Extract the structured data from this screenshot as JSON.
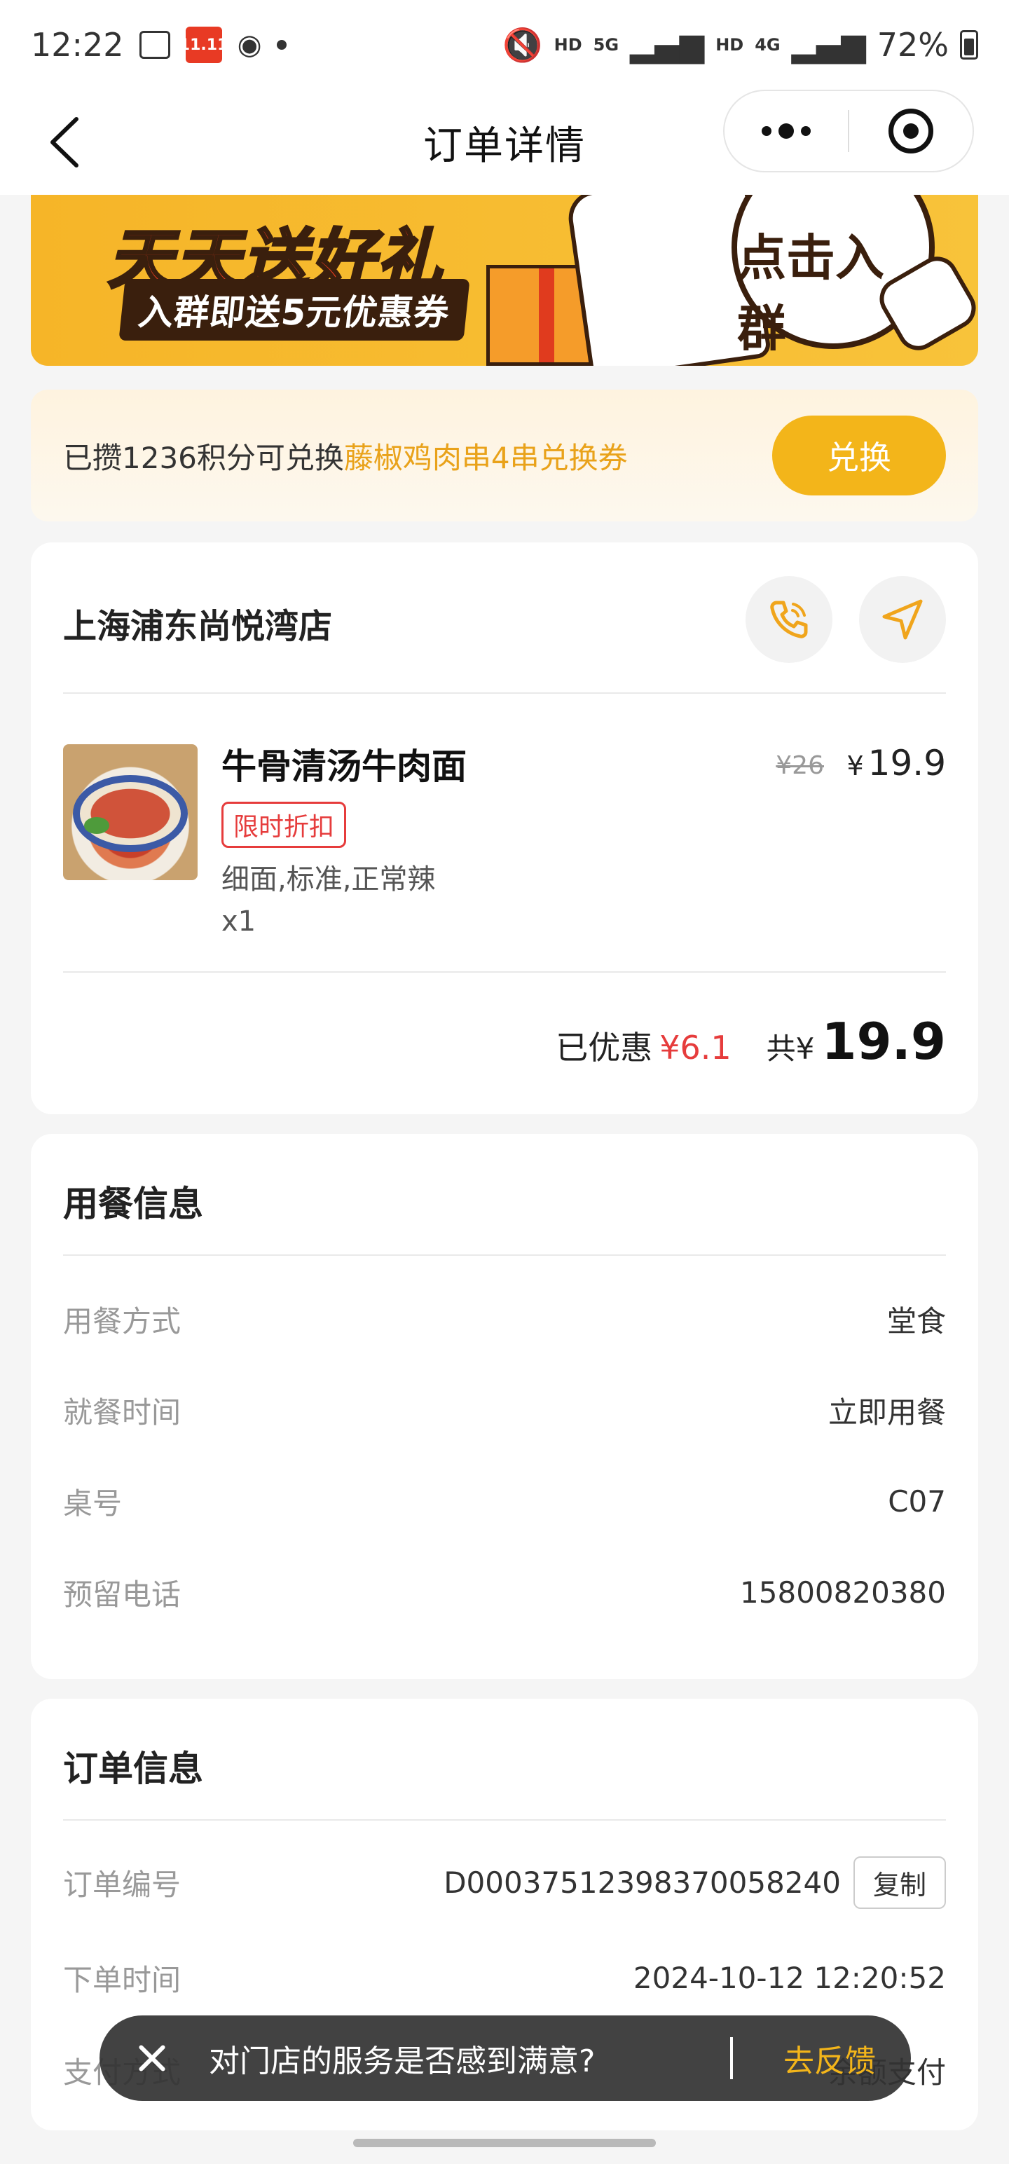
{
  "statusbar": {
    "time": "12:22",
    "battery_pct": "72%",
    "net1": "HD",
    "net2": "5G",
    "net3": "HD",
    "net4": "4G",
    "taobao_label": "11.11"
  },
  "nav": {
    "title": "订单详情"
  },
  "banner": {
    "title": "天天送好礼",
    "subtitle": "入群即送5元优惠券",
    "cta": "点击入群"
  },
  "points": {
    "text_prefix": "已攒1236积分可兑换",
    "text_highlight": "藤椒鸡肉串4串兑换券",
    "button": "兑换"
  },
  "store": {
    "name": "上海浦东尚悦湾店",
    "item": {
      "name": "牛骨清汤牛肉面",
      "tag": "限时折扣",
      "spec": "细面,标准,正常辣",
      "qty": "x1",
      "orig_price": "¥26",
      "currency": "¥",
      "price": "19.9"
    },
    "summary": {
      "discount_label": "已优惠",
      "discount_value": "¥6.1",
      "total_label": "共¥",
      "total": "19.9"
    }
  },
  "dine": {
    "title": "用餐信息",
    "rows": [
      {
        "k": "用餐方式",
        "v": "堂食"
      },
      {
        "k": "就餐时间",
        "v": "立即用餐"
      },
      {
        "k": "桌号",
        "v": "C07"
      },
      {
        "k": "预留电话",
        "v": "15800820380"
      }
    ]
  },
  "order": {
    "title": "订单信息",
    "rows": [
      {
        "k": "订单编号",
        "v": "D0003751239837005824​0"
      },
      {
        "k": "下单时间",
        "v": "2024-10-12 12:20:52"
      },
      {
        "k": "支付方式",
        "v": "余额支付"
      }
    ],
    "copy_label": "复制"
  },
  "toast": {
    "message": "对门店的服务是否感到满意?",
    "action": "去反馈"
  }
}
